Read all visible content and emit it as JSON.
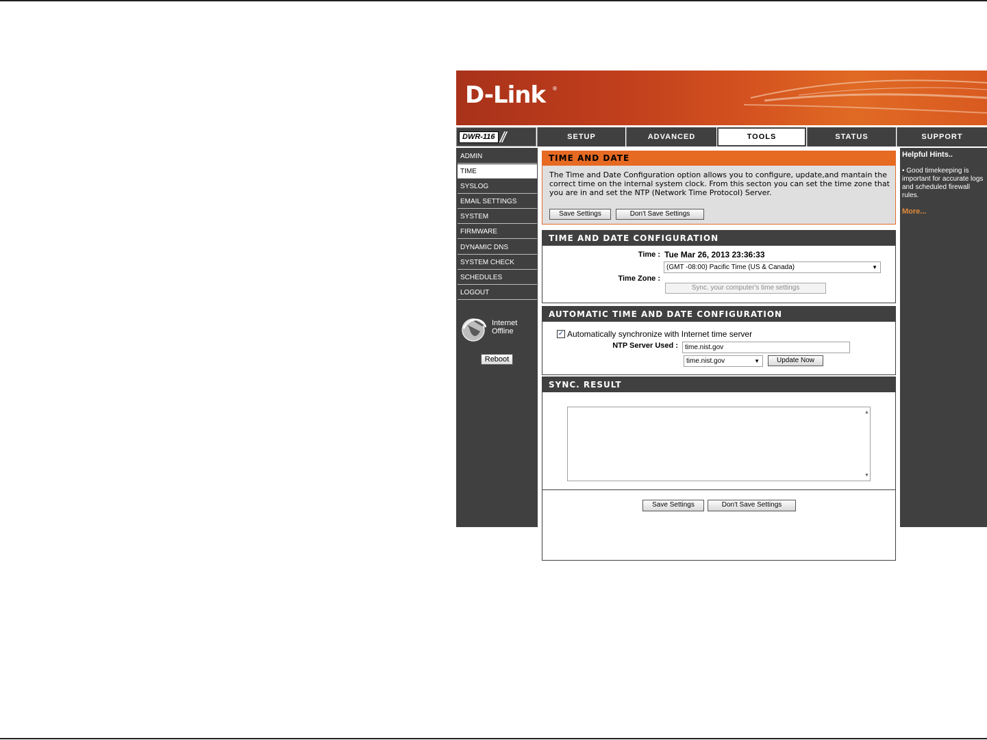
{
  "brand": {
    "logo_text": "D-Link",
    "registered": "®",
    "model": "DWR-116"
  },
  "nav": {
    "tabs": [
      {
        "label": "SETUP"
      },
      {
        "label": "ADVANCED"
      },
      {
        "label": "TOOLS",
        "active": true
      },
      {
        "label": "STATUS"
      },
      {
        "label": "SUPPORT"
      }
    ]
  },
  "sidebar": {
    "items": [
      {
        "label": "ADMIN"
      },
      {
        "label": "TIME",
        "active": true
      },
      {
        "label": "SYSLOG"
      },
      {
        "label": "EMAIL SETTINGS"
      },
      {
        "label": "SYSTEM"
      },
      {
        "label": "FIRMWARE"
      },
      {
        "label": "DYNAMIC DNS"
      },
      {
        "label": "SYSTEM CHECK"
      },
      {
        "label": "SCHEDULES"
      },
      {
        "label": "LOGOUT"
      }
    ],
    "internet_status_line1": "Internet",
    "internet_status_line2": "Offline",
    "reboot_label": "Reboot"
  },
  "intro": {
    "title": "TIME AND DATE",
    "text": "The Time and Date Configuration option allows you to configure, update,and mantain the correct time on the internal system clock. From this secton you can set the time zone that you are in and set the NTP (Network Time Protocol) Server.",
    "save_label": "Save Settings",
    "dont_save_label": "Don't Save Settings"
  },
  "config": {
    "title": "TIME AND DATE CONFIGURATION",
    "time_label": "Time :",
    "time_value": "Tue Mar 26, 2013 23:36:33",
    "timezone_label": "Time Zone :",
    "timezone_value": "(GMT -08:00) Pacific Time (US & Canada)",
    "sync_button_label": "Sync. your computer's time settings"
  },
  "auto": {
    "title": "AUTOMATIC TIME AND DATE CONFIGURATION",
    "checkbox_label": "Automatically synchronize with Internet time server",
    "checked": true,
    "ntp_label": "NTP Server Used :",
    "ntp_value": "time.nist.gov",
    "ntp_select_value": "time.nist.gov",
    "update_label": "Update Now"
  },
  "sync_result": {
    "title": "SYNC. RESULT",
    "content": ""
  },
  "footer": {
    "save_label": "Save Settings",
    "dont_save_label": "Don't Save Settings"
  },
  "hints": {
    "title": "Helpful Hints..",
    "bullet": "• Good timekeeping is important for accurate logs and scheduled firewall rules.",
    "more_label": "More..."
  }
}
